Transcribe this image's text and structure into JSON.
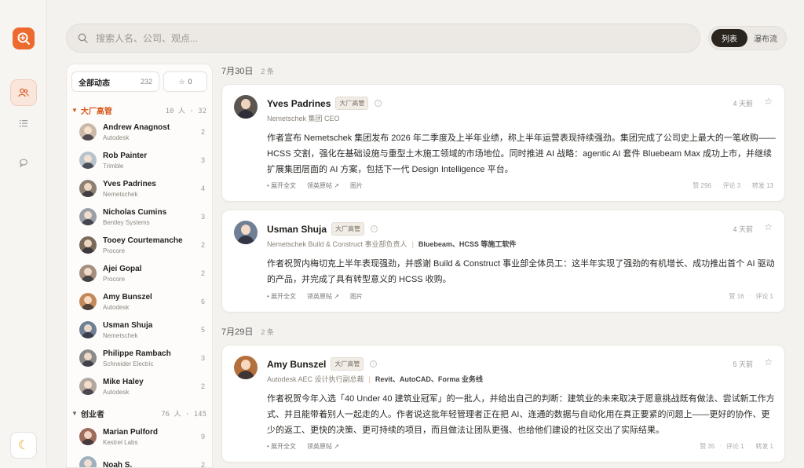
{
  "search": {
    "placeholder": "搜索人名、公司、观点..."
  },
  "view": {
    "list": "列表",
    "waterfall": "瀑布流"
  },
  "sidebar": {
    "all_label": "全部动态",
    "all_count": "232",
    "starred_count": "0",
    "groups": [
      {
        "name": "大厂高管",
        "meta": "10 人 · 32"
      },
      {
        "name": "创业者",
        "meta": "76 人 · 145"
      }
    ],
    "people": [
      {
        "name": "Andrew Anagnost",
        "company": "Autodesk",
        "count": "2",
        "color": "#c9b9a8"
      },
      {
        "name": "Rob Painter",
        "company": "Trimble",
        "count": "3",
        "color": "#b7c3cc"
      },
      {
        "name": "Yves Padrines",
        "company": "Nemetschek",
        "count": "4",
        "color": "#8d7f72"
      },
      {
        "name": "Nicholas Cumins",
        "company": "Bentley Systems",
        "count": "3",
        "color": "#9a9fa8"
      },
      {
        "name": "Tooey Courtemanche",
        "company": "Procore",
        "count": "2",
        "color": "#7a6a5a"
      },
      {
        "name": "Ajei Gopal",
        "company": "Procore",
        "count": "2",
        "color": "#a48f7e"
      },
      {
        "name": "Amy Bunszel",
        "company": "Autodesk",
        "count": "6",
        "color": "#c28a5a"
      },
      {
        "name": "Usman Shuja",
        "company": "Nemetschek",
        "count": "5",
        "color": "#6f7f96"
      },
      {
        "name": "Philippe Rambach",
        "company": "Schneider Electric",
        "count": "3",
        "color": "#8a8a8a"
      },
      {
        "name": "Mike Haley",
        "company": "Autodesk",
        "count": "2",
        "color": "#b3a8a0"
      },
      {
        "name": "Marian Pulford",
        "company": "Kestrel Labs",
        "count": "9",
        "color": "#9c6c5c"
      },
      {
        "name": "Noah S.",
        "company": "",
        "count": "2",
        "color": "#9fb0bf"
      }
    ]
  },
  "feed": {
    "days": [
      {
        "date": "7月30日",
        "count": "2 条"
      },
      {
        "date": "7月29日",
        "count": "2 条"
      }
    ],
    "posts": [
      {
        "name": "Yves Padrines",
        "tag": "大厂高管",
        "role": "Nemetschek 集团 CEO",
        "biz": "",
        "time": "4 天前",
        "body": "作者宣布 Nemetschek 集团发布 2026 年二季度及上半年业绩，称上半年运营表现持续强劲。集团完成了公司史上最大的一笔收购——HCSS 交割，强化在基础设施与重型土木施工领域的市场地位。同时推进 AI 战略：agentic AI 套件 Bluebeam Max 成功上市，并继续扩展集团层面的 AI 方案，包括下一代 Design Intelligence 平台。",
        "expand": "• 展开全文",
        "original": "领英原帖 ↗",
        "image": "图片",
        "stats": [
          "赞 296",
          "评论 3",
          "转发 13"
        ],
        "avatar_color": "#5d5550"
      },
      {
        "name": "Usman Shuja",
        "tag": "大厂高管",
        "role": "Nemetschek Build & Construct 事业部负责人",
        "biz": "Bluebeam、HCSS 等施工软件",
        "time": "4 天前",
        "body": "作者祝贺内梅切克上半年表现强劲，并感谢 Build & Construct 事业部全体员工：这半年实现了强劲的有机增长、成功推出首个 AI 驱动的产品，并完成了具有转型意义的 HCSS 收购。",
        "expand": "• 展开全文",
        "original": "领英原帖 ↗",
        "image": "图片",
        "stats": [
          "赞 16",
          "评论 1"
        ],
        "avatar_color": "#6f7f96"
      },
      {
        "name": "Amy Bunszel",
        "tag": "大厂高管",
        "role": "Autodesk AEC 设计执行副总裁",
        "biz": "Revit、AutoCAD、Forma 业务线",
        "time": "5 天前",
        "body": "作者祝贺今年入选「40 Under 40 建筑业冠军」的一批人，并给出自己的判断：建筑业的未来取决于愿意挑战既有做法、尝试新工作方式、并且能带着别人一起走的人。作者说这批年轻管理者正在把 AI、连通的数据与自动化用在真正要紧的问题上——更好的协作、更少的返工、更快的决策、更可持续的项目，而且做法让团队更强、也给他们建设的社区交出了实际结果。",
        "expand": "• 展开全文",
        "original": "领英原帖 ↗",
        "image": "",
        "stats": [
          "赞 35",
          "评论 1",
          "转发 1"
        ],
        "avatar_color": "#b3703c"
      }
    ]
  },
  "colors": {
    "accent": "#ec6a2d",
    "dark_toggle": "#2a241e"
  }
}
